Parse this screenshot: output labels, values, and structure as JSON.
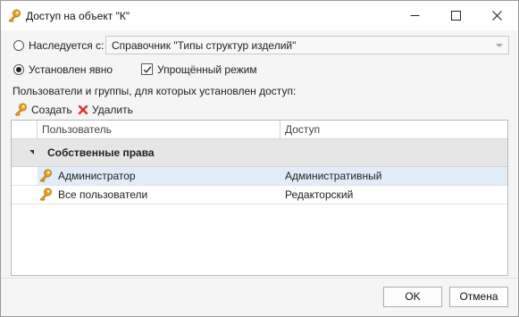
{
  "window": {
    "title": "Доступ на объект \"К\"",
    "title_icon": "key-icon",
    "controls": {
      "minimize": "minimize-icon",
      "maximize": "maximize-icon",
      "close": "close-icon"
    }
  },
  "inheritance": {
    "inherited_label": "Наследуется с:",
    "inherited_selected": false,
    "source_value": "Справочник \"Типы структур изделий\"",
    "explicit_label": "Установлен явно",
    "explicit_selected": true,
    "simplified_label": "Упрощённый режим",
    "simplified_checked": true
  },
  "users_section_label": "Пользователи и группы, для которых установлен доступ:",
  "toolbar": {
    "create_label": "Создать",
    "create_icon": "key-icon",
    "delete_label": "Удалить",
    "delete_icon": "red-x-icon"
  },
  "grid": {
    "columns": [
      "Пользователь",
      "Доступ"
    ],
    "group": {
      "label": "Собственные права",
      "expanded": true
    },
    "rows": [
      {
        "user": "Администратор",
        "access": "Административный",
        "selected": true,
        "icon": "key-icon"
      },
      {
        "user": "Все пользователи",
        "access": "Редакторский",
        "selected": false,
        "icon": "key-icon"
      }
    ]
  },
  "footer": {
    "ok_label": "OK",
    "cancel_label": "Отмена"
  },
  "colors": {
    "accent_key": "#e8a52a",
    "delete_red": "#d9302a",
    "selection": "#e0edf9",
    "group_bg": "#e6e6e6"
  }
}
